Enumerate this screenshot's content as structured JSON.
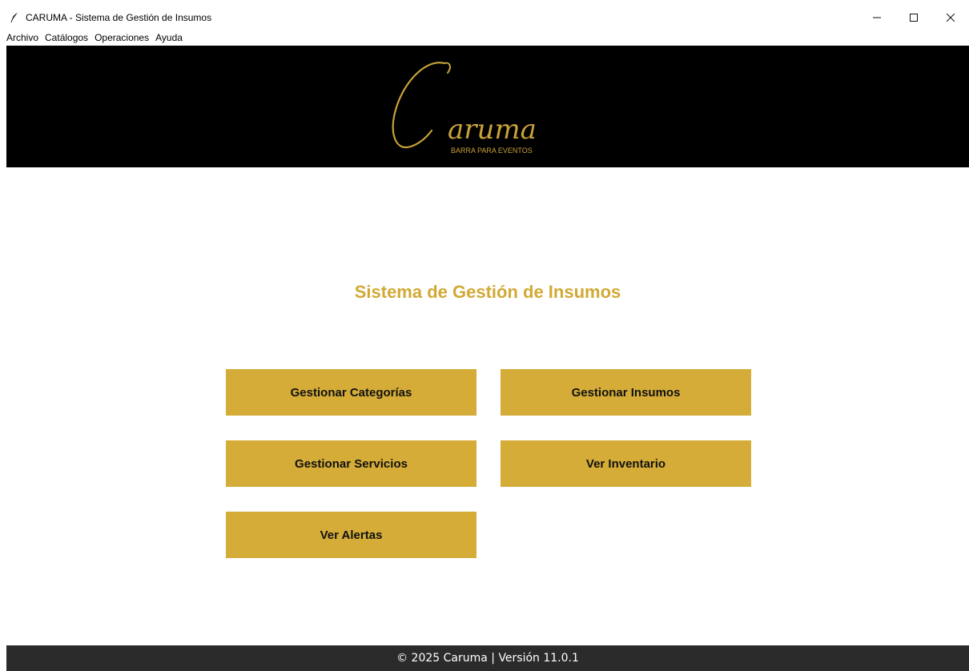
{
  "window": {
    "title": "CARUMA - Sistema de Gestión de Insumos",
    "icon": "feather-icon",
    "controls": [
      "minimize-icon",
      "maximize-icon",
      "close-icon"
    ]
  },
  "menu": {
    "items": [
      {
        "label": "Archivo"
      },
      {
        "label": "Catálogos"
      },
      {
        "label": "Operaciones"
      },
      {
        "label": "Ayuda"
      }
    ]
  },
  "banner": {
    "logo_text": "aruma",
    "logo_initial": "C",
    "logo_subtitle": "BARRA PARA EVENTOS"
  },
  "main": {
    "title": "Sistema de Gestión de Insumos",
    "buttons": [
      {
        "label": "Gestionar Categorías"
      },
      {
        "label": "Gestionar Insumos"
      },
      {
        "label": "Gestionar Servicios"
      },
      {
        "label": "Ver Inventario"
      },
      {
        "label": "Ver Alertas"
      }
    ]
  },
  "footer": {
    "text": "© 2025 Caruma | Versión 11.0.1"
  },
  "colors": {
    "accent_gold": "#d4ac37",
    "title_gold": "#d1a935",
    "banner_bg": "#000000",
    "footer_bg": "#2b2b2b"
  }
}
